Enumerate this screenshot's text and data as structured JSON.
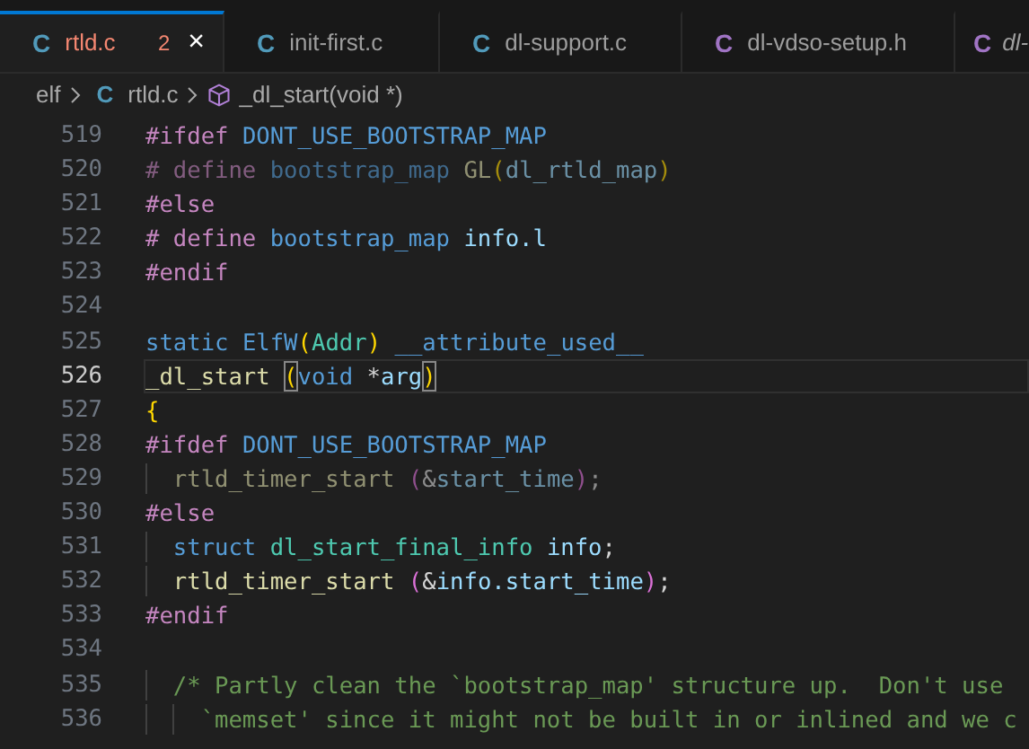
{
  "tabs": [
    {
      "icon_letter": "C",
      "kind": "source",
      "label": "rtld.c",
      "problems": "2",
      "selected": true,
      "has_errors": true,
      "preview": false,
      "close": "×"
    },
    {
      "icon_letter": "C",
      "kind": "source",
      "label": "init-first.c",
      "selected": false,
      "has_errors": false,
      "preview": false
    },
    {
      "icon_letter": "C",
      "kind": "source",
      "label": "dl-support.c",
      "selected": false,
      "has_errors": false,
      "preview": false
    },
    {
      "icon_letter": "C",
      "kind": "header",
      "label": "dl-vdso-setup.h",
      "selected": false,
      "has_errors": false,
      "preview": false
    },
    {
      "icon_letter": "C",
      "kind": "header",
      "label": "dl-",
      "selected": false,
      "has_errors": false,
      "preview": true
    }
  ],
  "breadcrumb": {
    "folder": "elf",
    "file_icon_letter": "C",
    "file": "rtld.c",
    "symbol": "_dl_start(void *)"
  },
  "lines": [
    {
      "number": "519",
      "current": false,
      "inactive": false,
      "tokens": [
        {
          "kind": "pp",
          "text": "#ifdef"
        },
        {
          "kind": "macro",
          "text": " DONT_USE_BOOTSTRAP_MAP"
        }
      ]
    },
    {
      "number": "520",
      "current": false,
      "inactive": true,
      "tokens": [
        {
          "kind": "pp",
          "text": "# define"
        },
        {
          "kind": "macro",
          "text": " bootstrap_map"
        },
        {
          "kind": "func",
          "text": " GL"
        },
        {
          "kind": "bracket",
          "text": "("
        },
        {
          "kind": "var",
          "text": "dl_rtld_map"
        },
        {
          "kind": "bracket",
          "text": ")"
        }
      ]
    },
    {
      "number": "521",
      "current": false,
      "inactive": false,
      "tokens": [
        {
          "kind": "pp",
          "text": "#else"
        }
      ]
    },
    {
      "number": "522",
      "current": false,
      "inactive": false,
      "tokens": [
        {
          "kind": "pp",
          "text": "# define"
        },
        {
          "kind": "macro",
          "text": " bootstrap_map"
        },
        {
          "kind": "var",
          "text": " info.l"
        }
      ]
    },
    {
      "number": "523",
      "current": false,
      "inactive": false,
      "tokens": [
        {
          "kind": "pp",
          "text": "#endif"
        }
      ]
    },
    {
      "number": "524",
      "current": false
    },
    {
      "number": "525",
      "current": false,
      "inactive": false,
      "tokens": [
        {
          "kind": "keyword",
          "text": "static"
        },
        {
          "kind": "macro",
          "text": " ElfW"
        },
        {
          "kind": "bracket",
          "text": "("
        },
        {
          "kind": "type",
          "text": "Addr"
        },
        {
          "kind": "bracket",
          "text": ")"
        },
        {
          "kind": "macro",
          "text": " __attribute_used__"
        }
      ]
    },
    {
      "number": "526",
      "current": true,
      "inactive": false,
      "tokens": [
        {
          "kind": "func",
          "text": "_dl_start "
        },
        {
          "kind": "bracket-match",
          "text": "("
        },
        {
          "kind": "keyword",
          "text": "void"
        },
        {
          "kind": "plain",
          "text": " *"
        },
        {
          "kind": "var",
          "text": "arg"
        },
        {
          "kind": "bracket-match",
          "text": ")"
        }
      ]
    },
    {
      "number": "527",
      "current": false,
      "inactive": false,
      "tokens": [
        {
          "kind": "bracket",
          "text": "{"
        }
      ]
    },
    {
      "number": "528",
      "current": false,
      "inactive": false,
      "tokens": [
        {
          "kind": "pp",
          "text": "#ifdef"
        },
        {
          "kind": "macro",
          "text": " DONT_USE_BOOTSTRAP_MAP"
        }
      ]
    },
    {
      "number": "529",
      "current": false,
      "inactive": true,
      "tokens": [
        {
          "kind": "func",
          "text": "  rtld_timer_start "
        },
        {
          "kind": "bracket2",
          "text": "("
        },
        {
          "kind": "plain",
          "text": "&"
        },
        {
          "kind": "var",
          "text": "start_time"
        },
        {
          "kind": "bracket2",
          "text": ")"
        },
        {
          "kind": "plain",
          "text": ";"
        }
      ]
    },
    {
      "number": "530",
      "current": false,
      "inactive": false,
      "tokens": [
        {
          "kind": "pp",
          "text": "#else"
        }
      ]
    },
    {
      "number": "531",
      "current": false,
      "inactive": false,
      "tokens": [
        {
          "kind": "keyword",
          "text": "  struct"
        },
        {
          "kind": "type",
          "text": " dl_start_final_info"
        },
        {
          "kind": "var",
          "text": " info"
        },
        {
          "kind": "plain",
          "text": ";"
        }
      ]
    },
    {
      "number": "532",
      "current": false,
      "inactive": false,
      "tokens": [
        {
          "kind": "func",
          "text": "  rtld_timer_start "
        },
        {
          "kind": "bracket2",
          "text": "("
        },
        {
          "kind": "plain",
          "text": "&"
        },
        {
          "kind": "var",
          "text": "info.start_time"
        },
        {
          "kind": "bracket2",
          "text": ")"
        },
        {
          "kind": "plain",
          "text": ";"
        }
      ]
    },
    {
      "number": "533",
      "current": false,
      "inactive": false,
      "tokens": [
        {
          "kind": "pp",
          "text": "#endif"
        }
      ]
    },
    {
      "number": "534",
      "current": false
    },
    {
      "number": "535",
      "current": false,
      "inactive": false,
      "tokens": [
        {
          "kind": "comment",
          "text": "  /* Partly clean the `bootstrap_map' structure up.  Don't use"
        }
      ]
    },
    {
      "number": "536",
      "current": false,
      "inactive": false,
      "tokens": [
        {
          "kind": "comment",
          "text": "    `memset' since it might not be built in or inlined and we c"
        }
      ]
    }
  ]
}
